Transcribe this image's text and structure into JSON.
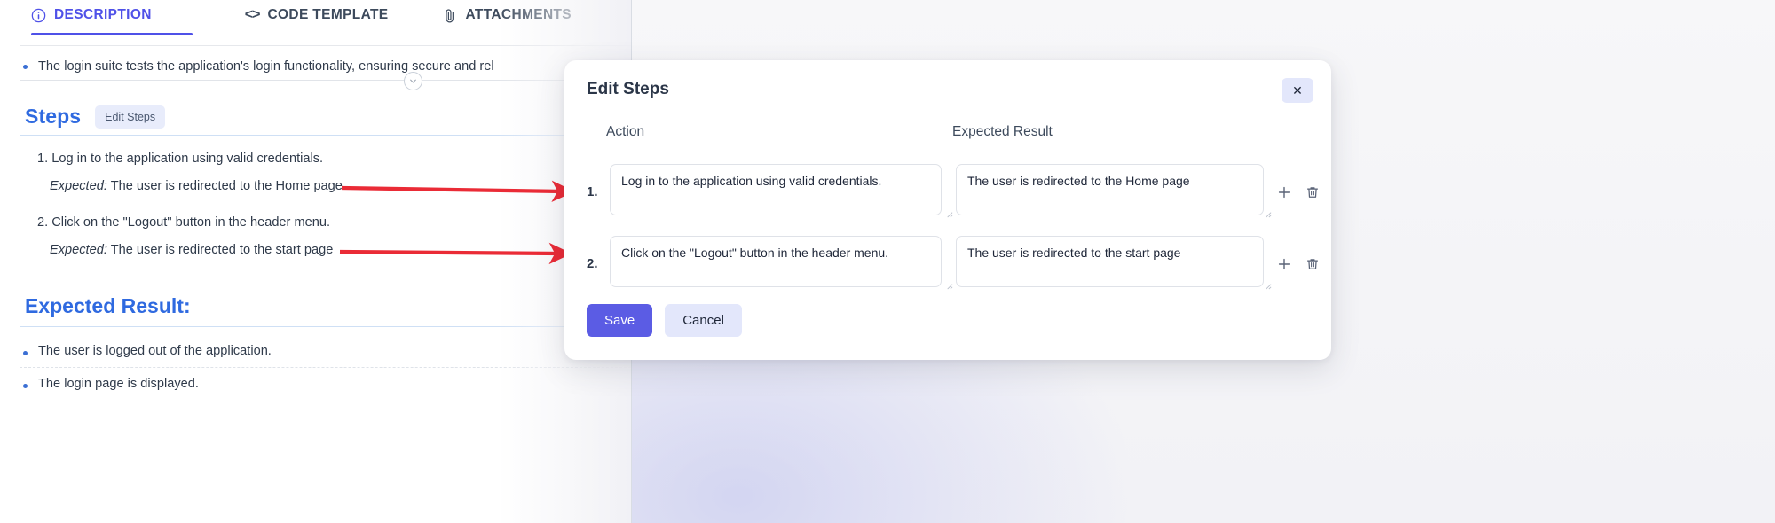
{
  "left_panel": {
    "tabs": [
      {
        "label": "DESCRIPTION",
        "icon": "info-circle-icon",
        "active": true
      },
      {
        "label": "CODE TEMPLATE",
        "icon": "code-brackets-icon",
        "active": false
      },
      {
        "label": "ATTACHMENTS",
        "icon": "paperclip-icon",
        "active": false
      }
    ],
    "description_bullet": "The login suite tests the application's login functionality, ensuring secure and rel",
    "steps_section": {
      "title": "Steps",
      "edit_button_label": "Edit Steps",
      "items": [
        {
          "number": "1.",
          "action": "Log in to the application using valid credentials.",
          "expected_label": "Expected:",
          "expected": "The user is redirected to the Home page"
        },
        {
          "number": "2.",
          "action": "Click on the \"Logout\" button in the header menu.",
          "expected_label": "Expected:",
          "expected": "The user is redirected to the start page"
        }
      ]
    },
    "expected_result_section": {
      "title": "Expected Result:",
      "items": [
        "The user is logged out of the application.",
        "The login page is displayed."
      ]
    }
  },
  "modal": {
    "title": "Edit Steps",
    "close_label": "✕",
    "columns": {
      "action": "Action",
      "expected": "Expected Result"
    },
    "rows": [
      {
        "number": "1.",
        "action": "Log in to the application using valid credentials.",
        "expected": "The user is redirected to the Home page",
        "add_icon": "plus-icon",
        "delete_icon": "trash-icon"
      },
      {
        "number": "2.",
        "action": "Click on the \"Logout\" button in the header menu.",
        "expected": "The user is redirected to the start page",
        "add_icon": "plus-icon",
        "delete_icon": "trash-icon"
      }
    ],
    "save_label": "Save",
    "cancel_label": "Cancel"
  },
  "annotations": {
    "arrow_color": "#ea2b36",
    "count": 2
  },
  "colors": {
    "accent_indigo": "#4f51e8",
    "save_button": "#5b5ce4",
    "heading_blue": "#2f6ae0",
    "text_slate": "#2f3a4a",
    "badge_lavender": "#e3e7fb"
  }
}
